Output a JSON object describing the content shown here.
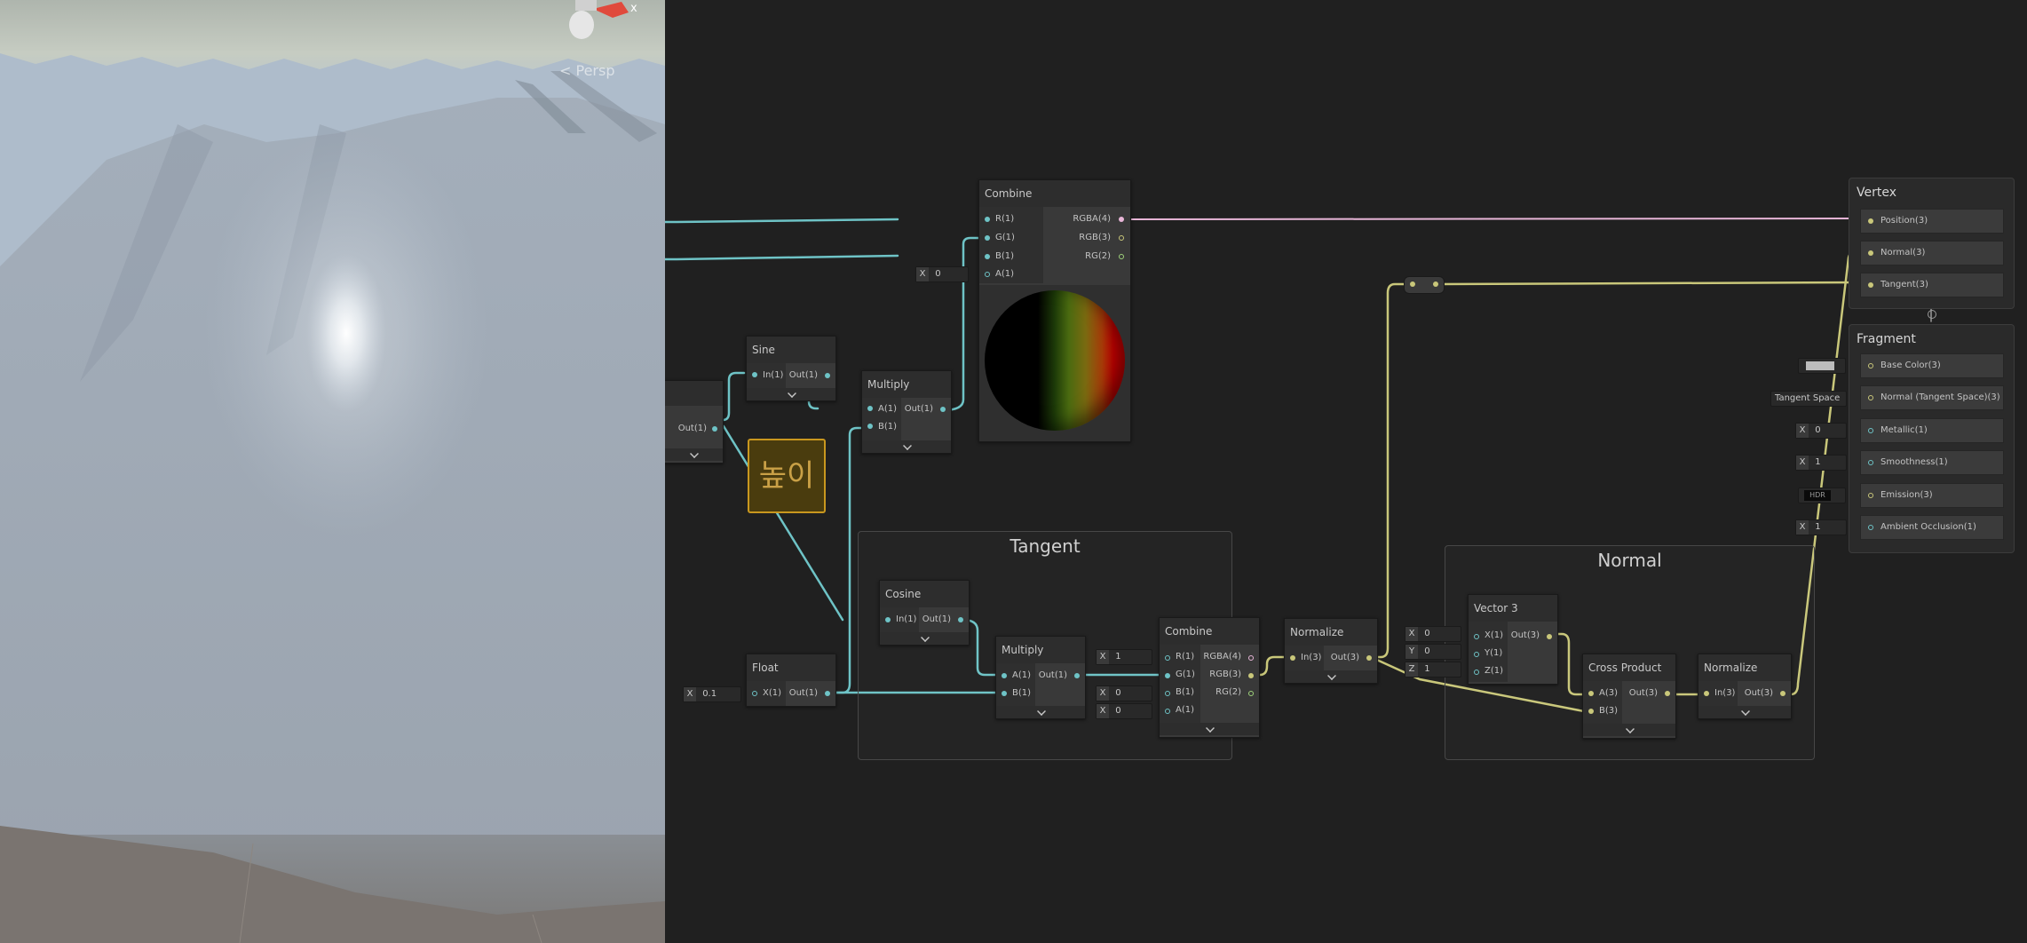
{
  "scene_view": {
    "mode_label": "< Persp",
    "gizmo_axis": "x"
  },
  "sticky_note": {
    "text": "높이"
  },
  "groups": {
    "tangent": "Tangent",
    "normal": "Normal"
  },
  "nodes": {
    "partial": {
      "out": "Out(1)"
    },
    "sine": {
      "title": "Sine",
      "in": "In(1)",
      "out": "Out(1)"
    },
    "multiply1": {
      "title": "Multiply",
      "a": "A(1)",
      "b": "B(1)",
      "out": "Out(1)"
    },
    "combine1": {
      "title": "Combine",
      "inputs": [
        "R(1)",
        "G(1)",
        "B(1)",
        "A(1)"
      ],
      "outputs": [
        "RGBA(4)",
        "RGB(3)",
        "RG(2)"
      ],
      "a_value": "0"
    },
    "cosine": {
      "title": "Cosine",
      "in": "In(1)",
      "out": "Out(1)"
    },
    "float": {
      "title": "Float",
      "in": "X(1)",
      "out": "Out(1)",
      "value": "0.1"
    },
    "multiply2": {
      "title": "Multiply",
      "a": "A(1)",
      "b": "B(1)",
      "out": "Out(1)"
    },
    "combine2": {
      "title": "Combine",
      "inputs": [
        "R(1)",
        "G(1)",
        "B(1)",
        "A(1)"
      ],
      "outputs": [
        "RGBA(4)",
        "RGB(3)",
        "RG(2)"
      ],
      "r_value": "1",
      "b_value": "0",
      "a_value": "0"
    },
    "normalize1": {
      "title": "Normalize",
      "in": "In(3)",
      "out": "Out(3)"
    },
    "vector3": {
      "title": "Vector 3",
      "inputs": [
        "X(1)",
        "Y(1)",
        "Z(1)"
      ],
      "out": "Out(3)",
      "x_value": "0",
      "y_value": "0",
      "z_value": "1"
    },
    "cross": {
      "title": "Cross Product",
      "a": "A(3)",
      "b": "B(3)",
      "out": "Out(3)"
    },
    "normalize2": {
      "title": "Normalize",
      "in": "In(3)",
      "out": "Out(3)"
    }
  },
  "vertex_stack": {
    "title": "Vertex",
    "slots": [
      "Position(3)",
      "Normal(3)",
      "Tangent(3)"
    ]
  },
  "fragment_stack": {
    "title": "Fragment",
    "slots": [
      "Base Color(3)",
      "Normal (Tangent Space)(3)",
      "Metallic(1)",
      "Smoothness(1)",
      "Emission(3)",
      "Ambient Occlusion(1)"
    ],
    "inline": {
      "normal_space": "Tangent Space",
      "metallic": "0",
      "smoothness": "1",
      "emission": "HDR",
      "ao": "1"
    }
  },
  "field_axes": {
    "x": "X",
    "y": "Y",
    "z": "Z"
  },
  "colors": {
    "float_wire": "#6ec3c6",
    "vector3_wire": "#c9c77a",
    "vector4_wire": "#e8b6d8",
    "sticky_border": "#c9971e"
  }
}
